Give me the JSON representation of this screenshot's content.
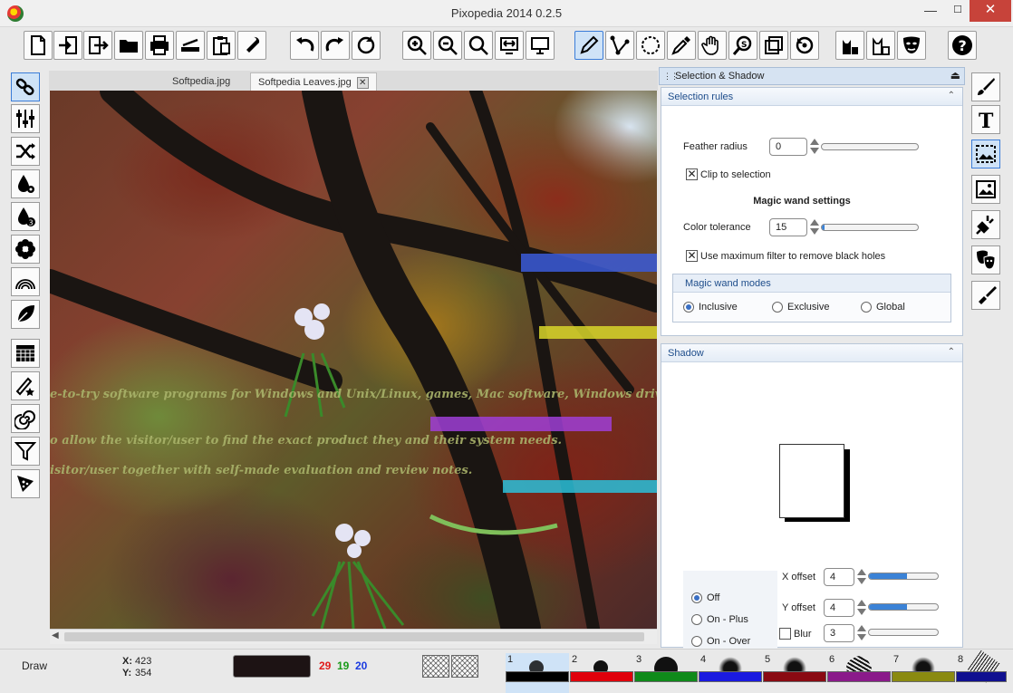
{
  "window": {
    "title": "Pixopedia 2014 0.2.5",
    "minimize": "—",
    "maximize": "☐",
    "close": "✕"
  },
  "tabs": [
    {
      "label": "Softpedia.jpg"
    },
    {
      "label": "Softpedia Leaves.jpg",
      "close": "✕"
    }
  ],
  "canvas_text": [
    "e-to-try software programs for Windows and Unix/Linux, games, Mac software, Windows drivers,",
    "o allow the visitor/user to find the exact product they and their system needs.",
    "isitor/user together with self-made evaluation and review notes."
  ],
  "panel": {
    "title": "Selection & Shadow",
    "selection_rules": {
      "header": "Selection rules",
      "feather_label": "Feather radius",
      "feather_value": "0",
      "feather_fraction": 0.0,
      "clip_label": "Clip to selection",
      "clip_checked": true,
      "magic_header": "Magic wand settings",
      "tolerance_label": "Color tolerance",
      "tolerance_value": "15",
      "tolerance_fraction": 0.03,
      "max_filter_label": "Use maximum filter to remove black holes",
      "max_filter_checked": true,
      "modes_header": "Magic wand modes",
      "modes": [
        "Inclusive",
        "Exclusive",
        "Global"
      ],
      "selected_mode": "Inclusive"
    },
    "shadow": {
      "header": "Shadow",
      "options": [
        "Off",
        "On - Plus",
        "On - Over"
      ],
      "selected": "Off",
      "xoffset_label": "X offset",
      "xoffset_value": "4",
      "xoffset_fraction": 0.55,
      "yoffset_label": "Y offset",
      "yoffset_value": "4",
      "yoffset_fraction": 0.55,
      "blur_label": "Blur",
      "blur_value": "3",
      "blur_fraction": 0.0,
      "blur_checked": false
    }
  },
  "status": {
    "mode": "Draw",
    "x_label": "X:",
    "x_value": "423",
    "y_label": "Y:",
    "y_value": "354",
    "r": "29",
    "g": "19",
    "b": "20",
    "current_color": "#1d1314"
  },
  "brush_swatches": [
    {
      "n": "1",
      "color": "#000000"
    },
    {
      "n": "2",
      "color": "#e0000b"
    },
    {
      "n": "3",
      "color": "#0f8a1a"
    },
    {
      "n": "4",
      "color": "#1a1ae0"
    },
    {
      "n": "5",
      "color": "#8a0a12"
    },
    {
      "n": "6",
      "color": "#8a1a8a"
    },
    {
      "n": "7",
      "color": "#8a8a10"
    },
    {
      "n": "8",
      "color": "#101090"
    }
  ]
}
